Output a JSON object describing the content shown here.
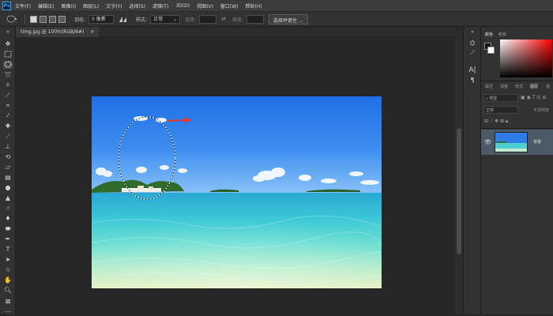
{
  "app": {
    "logo": "Ps"
  },
  "menu": [
    "文件(F)",
    "编辑(E)",
    "图像(I)",
    "图层(L)",
    "文字(Y)",
    "选择(S)",
    "滤镜(T)",
    "3D(D)",
    "视图(V)",
    "窗口(W)",
    "帮助(H)"
  ],
  "options": {
    "feather_label": "羽化:",
    "feather_value": "0 像素",
    "style_label": "样式:",
    "style_value": "正常",
    "width_label": "宽度:",
    "height_label": "高度:",
    "select_mask": "选择并遮住 ..."
  },
  "document": {
    "tab_title": "timg.jpg @ 100%(RGB/8#)",
    "close_glyph": "×"
  },
  "panels": {
    "color_tabs": [
      "颜色",
      "色板"
    ],
    "layer_tabs": [
      "属性",
      "调整",
      "样式",
      "图层",
      "通"
    ],
    "kind_filter": "类型",
    "blend_mode": "正常",
    "opacity_label": "不透明度",
    "layer_name": "背景"
  },
  "colors": {
    "selection_arrow": "#e53935",
    "accent": "#31a8ff",
    "panel_bg": "#323232"
  }
}
